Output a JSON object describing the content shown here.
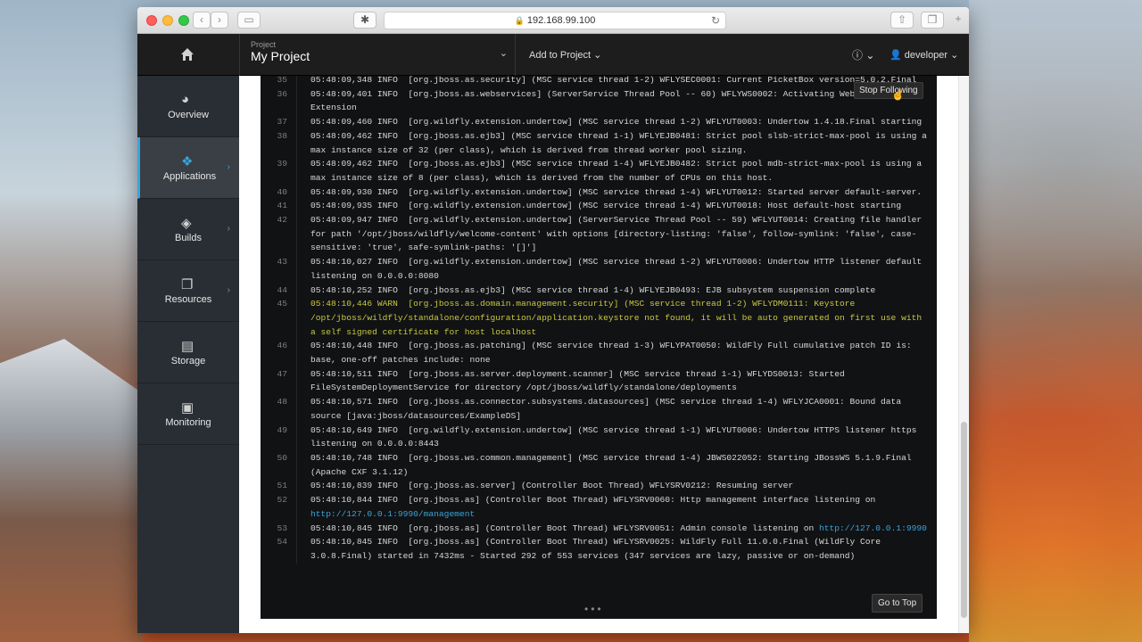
{
  "browser": {
    "url": "192.168.99.100"
  },
  "topnav": {
    "project_caption": "Project",
    "project_name": "My Project",
    "add_to_project": "Add to Project",
    "user": "developer"
  },
  "sidebar": {
    "items": [
      {
        "label": "Overview",
        "icon": "dashboard-icon"
      },
      {
        "label": "Applications",
        "icon": "cubes-icon"
      },
      {
        "label": "Builds",
        "icon": "layers-icon"
      },
      {
        "label": "Resources",
        "icon": "resources-icon"
      },
      {
        "label": "Storage",
        "icon": "storage-icon"
      },
      {
        "label": "Monitoring",
        "icon": "monitor-icon"
      }
    ]
  },
  "log": {
    "stop_following": "Stop Following",
    "go_to_top": "Go to Top",
    "lines": [
      {
        "n": "35",
        "t": "05:48:09,348 INFO  [org.jboss.as.security] (MSC service thread 1-2) WFLYSEC0001: Current PicketBox version=5.0.2.Final"
      },
      {
        "n": "36",
        "t": "05:48:09,401 INFO  [org.jboss.as.webservices] (ServerService Thread Pool -- 60) WFLYWS0002: Activating WebServices Extension"
      },
      {
        "n": "37",
        "t": "05:48:09,460 INFO  [org.wildfly.extension.undertow] (MSC service thread 1-2) WFLYUT0003: Undertow 1.4.18.Final starting"
      },
      {
        "n": "38",
        "t": "05:48:09,462 INFO  [org.jboss.as.ejb3] (MSC service thread 1-1) WFLYEJB0481: Strict pool slsb-strict-max-pool is using a max instance size of 32 (per class), which is derived from thread worker pool sizing."
      },
      {
        "n": "39",
        "t": "05:48:09,462 INFO  [org.jboss.as.ejb3] (MSC service thread 1-4) WFLYEJB0482: Strict pool mdb-strict-max-pool is using a max instance size of 8 (per class), which is derived from the number of CPUs on this host."
      },
      {
        "n": "40",
        "t": "05:48:09,930 INFO  [org.wildfly.extension.undertow] (MSC service thread 1-4) WFLYUT0012: Started server default-server."
      },
      {
        "n": "41",
        "t": "05:48:09,935 INFO  [org.wildfly.extension.undertow] (MSC service thread 1-4) WFLYUT0018: Host default-host starting"
      },
      {
        "n": "42",
        "t": "05:48:09,947 INFO  [org.wildfly.extension.undertow] (ServerService Thread Pool -- 59) WFLYUT0014: Creating file handler for path '/opt/jboss/wildfly/welcome-content' with options [directory-listing: 'false', follow-symlink: 'false', case-sensitive: 'true', safe-symlink-paths: '[]']"
      },
      {
        "n": "43",
        "t": "05:48:10,027 INFO  [org.wildfly.extension.undertow] (MSC service thread 1-2) WFLYUT0006: Undertow HTTP listener default listening on 0.0.0.0:8080"
      },
      {
        "n": "44",
        "t": "05:48:10,252 INFO  [org.jboss.as.ejb3] (MSC service thread 1-4) WFLYEJB0493: EJB subsystem suspension complete"
      },
      {
        "n": "45",
        "t": "05:48:10,446 WARN  [org.jboss.as.domain.management.security] (MSC service thread 1-2) WFLYDM0111: Keystore /opt/jboss/wildfly/standalone/configuration/application.keystore not found, it will be auto generated on first use with a self signed certificate for host localhost",
        "warn": true
      },
      {
        "n": "46",
        "t": "05:48:10,448 INFO  [org.jboss.as.patching] (MSC service thread 1-3) WFLYPAT0050: WildFly Full cumulative patch ID is: base, one-off patches include: none"
      },
      {
        "n": "47",
        "t": "05:48:10,511 INFO  [org.jboss.as.server.deployment.scanner] (MSC service thread 1-1) WFLYDS0013: Started FileSystemDeploymentService for directory /opt/jboss/wildfly/standalone/deployments"
      },
      {
        "n": "48",
        "t": "05:48:10,571 INFO  [org.jboss.as.connector.subsystems.datasources] (MSC service thread 1-4) WFLYJCA0001: Bound data source [java:jboss/datasources/ExampleDS]"
      },
      {
        "n": "49",
        "t": "05:48:10,649 INFO  [org.wildfly.extension.undertow] (MSC service thread 1-1) WFLYUT0006: Undertow HTTPS listener https listening on 0.0.0.0:8443"
      },
      {
        "n": "50",
        "t": "05:48:10,748 INFO  [org.jboss.ws.common.management] (MSC service thread 1-4) JBWS022052: Starting JBossWS 5.1.9.Final (Apache CXF 3.1.12)"
      },
      {
        "n": "51",
        "t": "05:48:10,839 INFO  [org.jboss.as.server] (Controller Boot Thread) WFLYSRV0212: Resuming server"
      },
      {
        "n": "52",
        "t": "05:48:10,844 INFO  [org.jboss.as] (Controller Boot Thread) WFLYSRV0060: Http management interface listening on ",
        "link": "http://127.0.0.1:9990/management"
      },
      {
        "n": "53",
        "t": "05:48:10,845 INFO  [org.jboss.as] (Controller Boot Thread) WFLYSRV0051: Admin console listening on ",
        "link": "http://127.0.0.1:9990"
      },
      {
        "n": "54",
        "t": "05:48:10,845 INFO  [org.jboss.as] (Controller Boot Thread) WFLYSRV0025: WildFly Full 11.0.0.Final (WildFly Core 3.0.8.Final) started in 7432ms - Started 292 of 553 services (347 services are lazy, passive or on-demand)"
      }
    ]
  }
}
